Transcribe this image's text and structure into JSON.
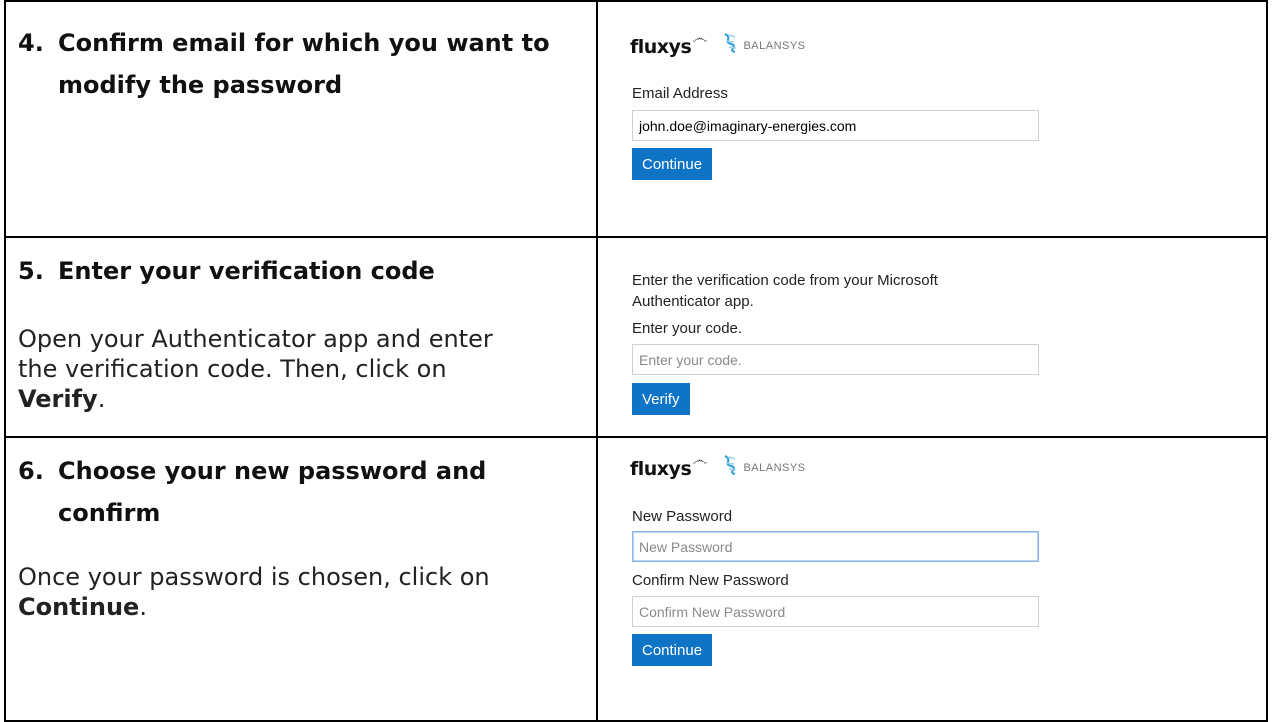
{
  "steps": [
    {
      "number": "4.",
      "title_line1": "Confirm email for which you want to",
      "title_line2": "modify the password",
      "panel": {
        "logo_fluxys": "fluxys",
        "logo_balansys": "BALANSYS",
        "email_label": "Email Address",
        "email_value": "john.doe@imaginary-energies.com",
        "button": "Continue"
      }
    },
    {
      "number": "5.",
      "title_line1": "Enter your verification code",
      "desc_line1": "Open your Authenticator app and enter",
      "desc_line2": "the verification code. Then, click on",
      "desc_bold": "Verify",
      "desc_end": ".",
      "panel": {
        "intro_line1": "Enter the verification code from your Microsoft",
        "intro_line2": "Authenticator app.",
        "code_label": "Enter your code.",
        "code_placeholder": "Enter your code.",
        "button": "Verify"
      }
    },
    {
      "number": "6.",
      "title_line1": "Choose your new password and",
      "title_line2": "confirm",
      "desc_line1": "Once your password is chosen, click on",
      "desc_bold": "Continue",
      "desc_end": ".",
      "panel": {
        "logo_fluxys": "fluxys",
        "logo_balansys": "BALANSYS",
        "new_password_label": "New Password",
        "new_password_placeholder": "New Password",
        "confirm_label": "Confirm New Password",
        "confirm_placeholder": "Confirm New Password",
        "button": "Continue"
      }
    }
  ]
}
